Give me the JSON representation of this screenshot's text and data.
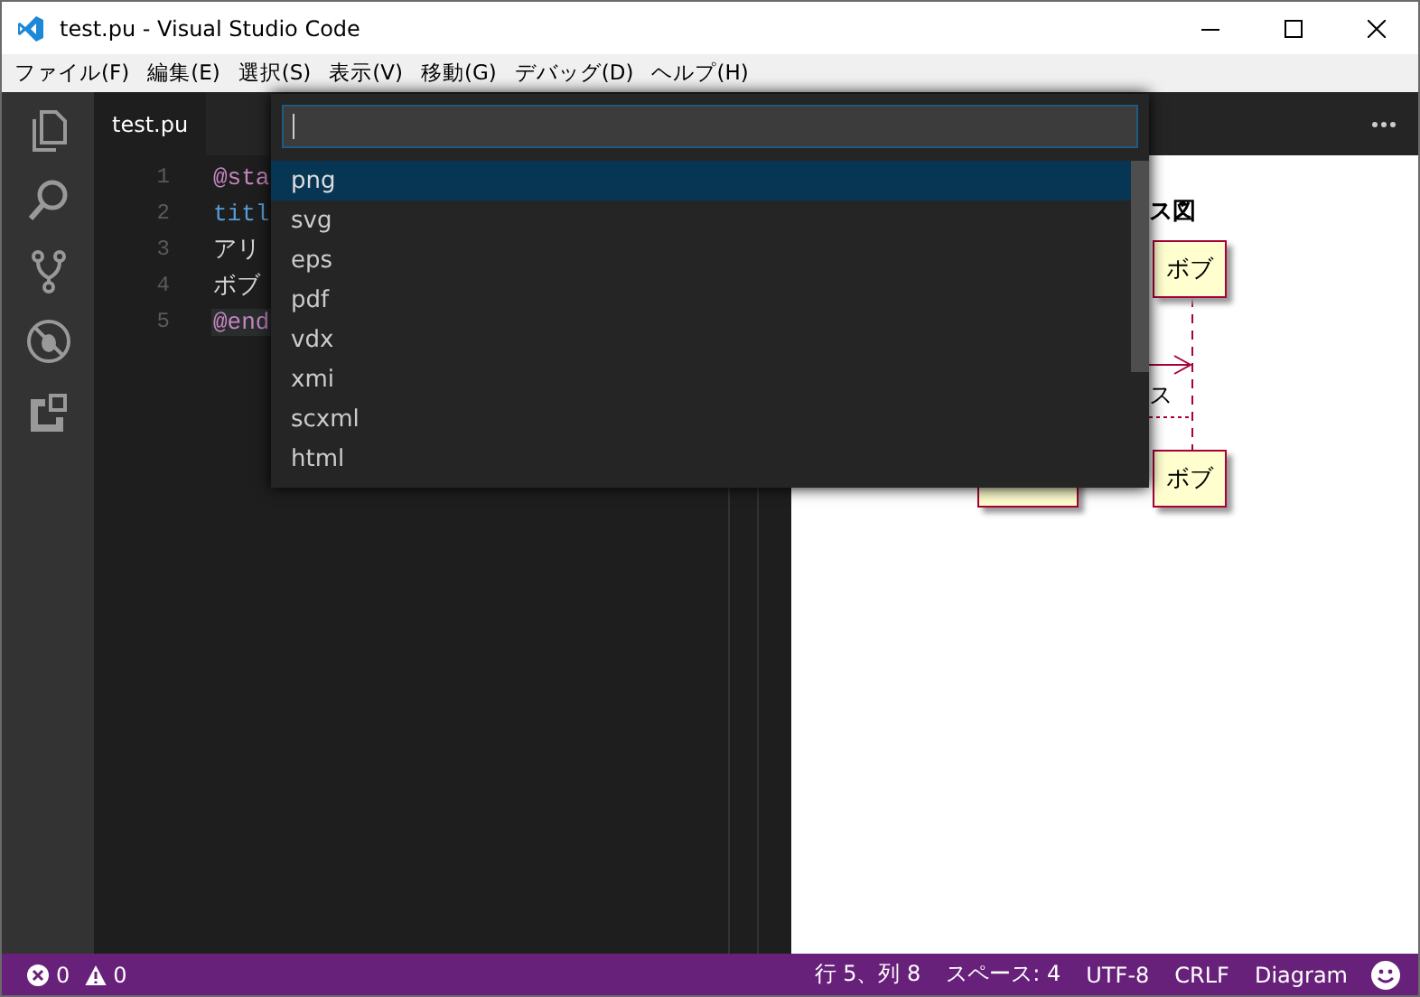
{
  "window": {
    "title": "test.pu - Visual Studio Code"
  },
  "menu": [
    "ファイル(F)",
    "編集(E)",
    "選択(S)",
    "表示(V)",
    "移動(G)",
    "デバッグ(D)",
    "ヘルプ(H)"
  ],
  "editor": {
    "tab": "test.pu",
    "lines": [
      {
        "number": "1",
        "text": "@sta",
        "kind": "directive",
        "current": false
      },
      {
        "number": "2",
        "text": "titl",
        "kind": "keyword",
        "current": false
      },
      {
        "number": "3",
        "text": "アリ",
        "kind": "text",
        "current": false
      },
      {
        "number": "4",
        "text": "ボブ",
        "kind": "text",
        "current": false
      },
      {
        "number": "5",
        "text": "@end",
        "kind": "directive",
        "current": true
      }
    ]
  },
  "quick_pick": {
    "items": [
      {
        "label": "png",
        "selected": true
      },
      {
        "label": "svg",
        "selected": false
      },
      {
        "label": "eps",
        "selected": false
      },
      {
        "label": "pdf",
        "selected": false
      },
      {
        "label": "vdx",
        "selected": false
      },
      {
        "label": "xmi",
        "selected": false
      },
      {
        "label": "scxml",
        "selected": false
      },
      {
        "label": "html",
        "selected": false
      }
    ]
  },
  "preview": {
    "title": "ス図",
    "participant_top": "ボブ",
    "message": "ス",
    "participant_bottom": "ボブ"
  },
  "status_bar": {
    "errors": "0",
    "warnings": "0",
    "items": [
      "行 5、列 8",
      "スペース: 4",
      "UTF-8",
      "CRLF",
      "Diagram"
    ]
  }
}
